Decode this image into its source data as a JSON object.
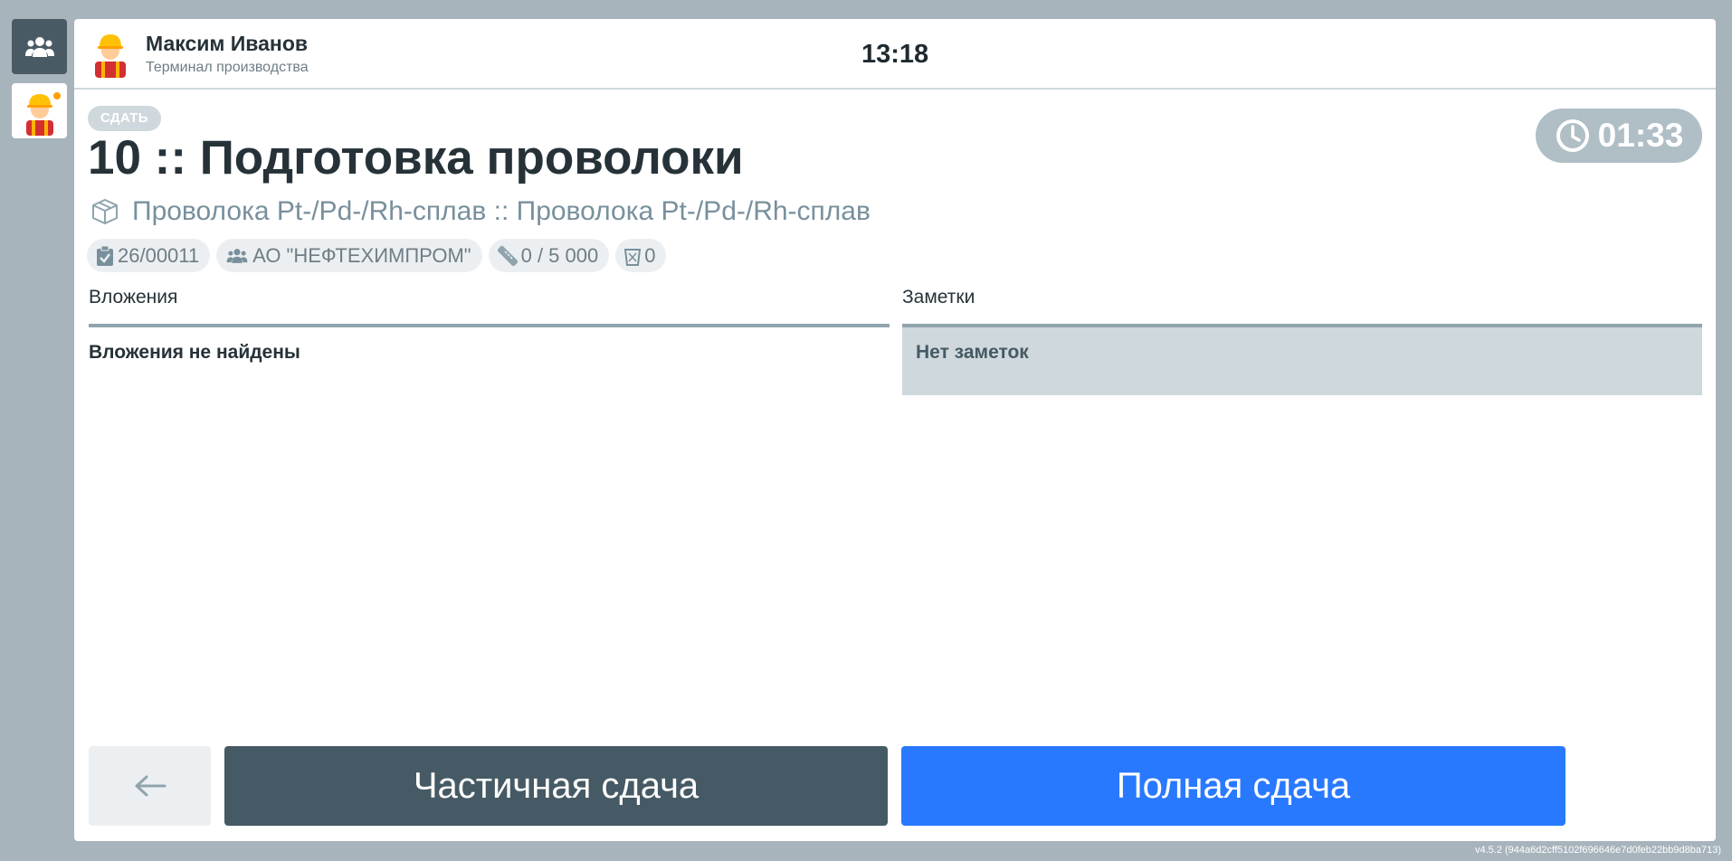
{
  "user": {
    "name": "Максим Иванов",
    "role": "Терминал производства"
  },
  "header": {
    "clock": "13:18"
  },
  "operation": {
    "action_badge": "СДАТЬ",
    "title": "10 :: Подготовка проволоки",
    "timer": "01:33",
    "product": "Проволока Pt-/Pd-/Rh-сплав :: Проволока Pt-/Pd-/Rh-сплав",
    "chips": {
      "order": "26/00011",
      "customer": "АО \"НЕФТЕХИМПРОМ\"",
      "quantity": "0 / 5 000",
      "scrap": "0"
    }
  },
  "attachments": {
    "title": "Вложения",
    "empty_text": "Вложения не найдены"
  },
  "notes": {
    "title": "Заметки",
    "empty_text": "Нет заметок"
  },
  "buttons": {
    "partial": "Частичная сдача",
    "full": "Полная сдача"
  },
  "footer": {
    "version": "v4.5.2 (944a6d2cff5102f696646e7d0feb22bb9d8ba713)"
  },
  "icons": {
    "team": "users-icon",
    "user_avatar": "worker-avatar-icon",
    "product": "box-icon",
    "order": "clipboard-check-icon",
    "customer": "users-icon",
    "quantity": "ruler-icon",
    "scrap": "trash-icon",
    "timer": "clock-icon",
    "back": "arrow-left-icon"
  },
  "colors": {
    "primary": "#2979ff",
    "dark": "#455a64",
    "sidebar_bg": "#a7b4bc",
    "online_dot": "#ffa000"
  }
}
